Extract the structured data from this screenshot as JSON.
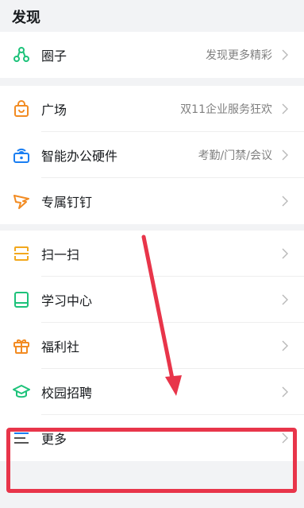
{
  "header": {
    "title": "发现"
  },
  "groups": [
    {
      "items": [
        {
          "label": "圈子",
          "hint": "发现更多精彩",
          "icon": "circle-group-icon"
        }
      ]
    },
    {
      "items": [
        {
          "label": "广场",
          "hint": "双11企业服务狂欢",
          "icon": "shopping-bag-icon"
        },
        {
          "label": "智能办公硬件",
          "hint": "考勤/门禁/会议",
          "icon": "smart-device-icon"
        },
        {
          "label": "专属钉钉",
          "hint": "",
          "icon": "dingtalk-wing-icon"
        }
      ]
    },
    {
      "items": [
        {
          "label": "扫一扫",
          "hint": "",
          "icon": "scan-icon"
        },
        {
          "label": "学习中心",
          "hint": "",
          "icon": "book-icon"
        },
        {
          "label": "福利社",
          "hint": "",
          "icon": "gift-icon"
        },
        {
          "label": "校园招聘",
          "hint": "",
          "icon": "graduation-cap-icon"
        },
        {
          "label": "更多",
          "hint": "",
          "icon": "menu-lines-icon"
        }
      ]
    }
  ],
  "colors": {
    "accent_green": "#1dc27a",
    "accent_orange": "#f28b22",
    "accent_blue": "#1a7ef2",
    "annotation_red": "#e8354a"
  }
}
